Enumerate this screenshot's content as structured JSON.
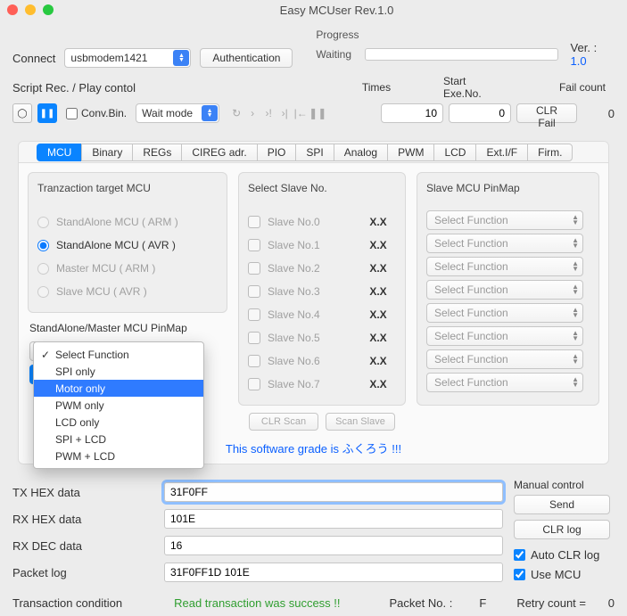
{
  "window": {
    "title": "Easy MCUser Rev.1.0"
  },
  "top": {
    "connect_label": "Connect",
    "port": "usbmodem1421",
    "auth_btn": "Authentication",
    "progress_label": "Progress",
    "progress_status": "Waiting",
    "ver_label": "Ver. : ",
    "ver_value": "1.0"
  },
  "script": {
    "label": "Script Rec. / Play contol",
    "convbin": "Conv.Bin.",
    "waitmode": "Wait mode",
    "times_label": "Times",
    "times_value": "10",
    "startno_label": "Start Exe.No.",
    "startno_value": "0",
    "clrfail_btn": "CLR Fail",
    "failcount_label": "Fail count",
    "failcount_value": "0"
  },
  "tabs": [
    "MCU",
    "Binary",
    "REGs",
    "CIREG adr.",
    "PIO",
    "SPI",
    "Analog",
    "PWM",
    "LCD",
    "Ext.I/F",
    "Firm."
  ],
  "active_tab": 0,
  "target_group": {
    "title": "Tranzaction target MCU",
    "options": [
      {
        "label": "StandAlone MCU ( ARM )",
        "checked": false,
        "enabled": false
      },
      {
        "label": "StandAlone MCU ( AVR )",
        "checked": true,
        "enabled": true
      },
      {
        "label": "Master MCU ( ARM )",
        "checked": false,
        "enabled": false
      },
      {
        "label": "Slave MCU ( AVR )",
        "checked": false,
        "enabled": false
      }
    ],
    "pinmap_title": "StandAlone/Master MCU PinMap",
    "pinmap_value": "Select Function"
  },
  "slave_group": {
    "title": "Select Slave No.",
    "rows": [
      {
        "label": "Slave No.0",
        "val": "X.X"
      },
      {
        "label": "Slave No.1",
        "val": "X.X"
      },
      {
        "label": "Slave No.2",
        "val": "X.X"
      },
      {
        "label": "Slave No.3",
        "val": "X.X"
      },
      {
        "label": "Slave No.4",
        "val": "X.X"
      },
      {
        "label": "Slave No.5",
        "val": "X.X"
      },
      {
        "label": "Slave No.6",
        "val": "X.X"
      },
      {
        "label": "Slave No.7",
        "val": "X.X"
      }
    ],
    "clr_scan": "CLR Scan",
    "scan_slave": "Scan Slave"
  },
  "pinmap_group": {
    "title": "Slave MCU PinMap",
    "values": [
      "Select Function",
      "Select Function",
      "Select Function",
      "Select Function",
      "Select Function",
      "Select Function",
      "Select Function",
      "Select Function"
    ]
  },
  "dropdown": {
    "options": [
      "Select Function",
      "SPI only",
      "Motor only",
      "PWM only",
      "LCD only",
      "SPI + LCD",
      "PWM + LCD"
    ],
    "checked": 0,
    "highlighted": 2
  },
  "grade_msg": "This software grade is ふくろう !!!",
  "fields": {
    "txhex_label": "TX HEX data",
    "txhex_value": "31F0FF",
    "rxhex_label": "RX HEX data",
    "rxhex_value": "101E",
    "rxdec_label": "RX DEC data",
    "rxdec_value": "16",
    "pktlog_label": "Packet log",
    "pktlog_value": "31F0FF1D 101E"
  },
  "manual": {
    "title": "Manual control",
    "send": "Send",
    "clrlog": "CLR log",
    "autoclr": "Auto CLR log",
    "usemcu": "Use MCU"
  },
  "footer": {
    "cond_label": "Transaction condition",
    "cond_value": "Read transaction was success !!",
    "pktno_label": "Packet No. :",
    "pktno_value": "F",
    "retry_label": "Retry count  =",
    "retry_value": "0"
  }
}
